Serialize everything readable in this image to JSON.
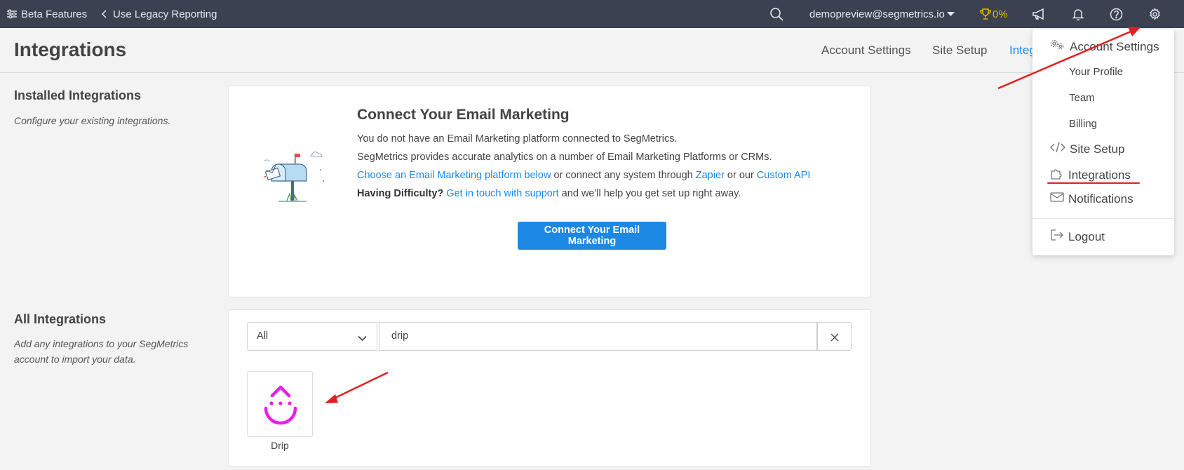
{
  "topbar": {
    "beta_features": "Beta Features",
    "legacy_reporting": "Use Legacy Reporting",
    "user_email": "demopreview@segmetrics.io",
    "progress_percent": "0%"
  },
  "header": {
    "title": "Integrations",
    "tabs": [
      {
        "label": "Account Settings"
      },
      {
        "label": "Site Setup"
      },
      {
        "label": "Integ"
      }
    ]
  },
  "installed": {
    "title": "Installed Integrations",
    "description": "Configure your existing integrations."
  },
  "connect_card": {
    "heading": "Connect Your Email Marketing",
    "line1": "You do not have an Email Marketing platform connected to SegMetrics.",
    "line2": "SegMetrics provides accurate analytics on a number of Email Marketing Platforms or CRMs.",
    "line3_link1": "Choose an Email Marketing platform below",
    "line3_text1": " or connect any system through ",
    "line3_link2": "Zapier",
    "line3_text2": " or our ",
    "line3_link3": "Custom API",
    "line4_bold": "Having Difficulty?",
    "line4_link": "Get in touch with support",
    "line4_text": " and we'll help you get set up right away.",
    "button_label": "Connect Your Email Marketing"
  },
  "all_integrations": {
    "title": "All Integrations",
    "description": "Add any integrations to your SegMetrics account to import your data.",
    "filter_value": "All",
    "search_value": "drip",
    "results": [
      {
        "label": "Drip"
      }
    ]
  },
  "dropdown": {
    "account_settings": "Account Settings",
    "your_profile": "Your Profile",
    "team": "Team",
    "billing": "Billing",
    "site_setup": "Site Setup",
    "integrations": "Integrations",
    "notifications": "Notifications",
    "logout": "Logout"
  },
  "colors": {
    "topbar_bg": "#3a4150",
    "accent": "#1e88e5",
    "drip": "#e91ee9",
    "annotation": "#e02020"
  }
}
